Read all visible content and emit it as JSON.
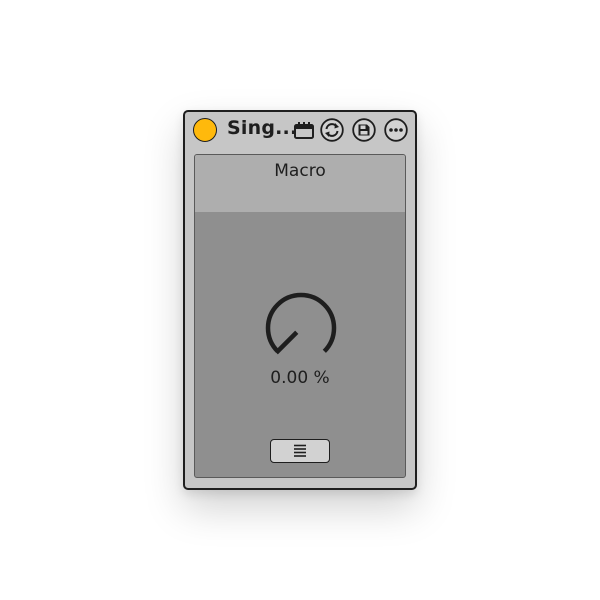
{
  "device": {
    "title": "Sing...",
    "power_color": "#ffb90c",
    "icons": {
      "clip": "clip-icon",
      "hot_swap": "hot-swap-icon",
      "save": "save-icon",
      "more": "more-options-icon"
    }
  },
  "macro": {
    "label": "Macro",
    "value_text": "0.00 %",
    "value_fraction": 0.0,
    "menu_icon": "list-menu-icon"
  },
  "colors": {
    "panel_bg": "#8f8f8f",
    "header_bg": "#aeaeae",
    "frame_bg": "#c6c6c6",
    "outline": "#1e1e1e"
  }
}
